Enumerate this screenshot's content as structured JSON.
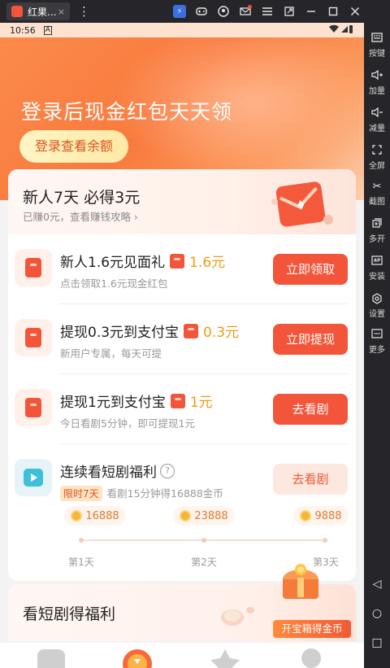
{
  "emulator": {
    "tab_title": "红果...",
    "tab_close": "×",
    "menu_glyph": "⋮",
    "toolbar_icons": [
      "bolt-icon",
      "gamepad-icon",
      "user-circle-icon",
      "mail-icon",
      "menu-icon",
      "external-window-icon",
      "minimize-icon",
      "maximize-icon",
      "close-icon",
      "collapse-icon"
    ],
    "sidebar": [
      {
        "icon": "keyboard-icon",
        "label": "按键"
      },
      {
        "icon": "volume-up-icon",
        "label": "加量"
      },
      {
        "icon": "volume-down-icon",
        "label": "减量"
      },
      {
        "icon": "fullscreen-icon",
        "label": "全屏"
      },
      {
        "icon": "scissors-icon",
        "label": "截图"
      },
      {
        "icon": "multi-instance-icon",
        "label": "多开"
      },
      {
        "icon": "apk-icon",
        "label": "安装"
      },
      {
        "icon": "settings-icon",
        "label": "设置"
      },
      {
        "icon": "more-icon",
        "label": "更多"
      }
    ],
    "nav": {
      "back": "◁",
      "home": "○",
      "recents": "□"
    }
  },
  "status_bar": {
    "time": "10:56",
    "notif": "A"
  },
  "hero": {
    "title": "登录后现金红包天天领",
    "login_button": "登录查看余额"
  },
  "newbie": {
    "title": "新人7天 必得3元",
    "subtitle": "已赚0元，查看赚钱攻略 ›"
  },
  "tasks": [
    {
      "title": "新人1.6元见面礼",
      "reward": "1.6元",
      "subtitle": "点击领取1.6元现金红包",
      "button": "立即领取",
      "style": "primary"
    },
    {
      "title": "提现0.3元到支付宝",
      "reward": "0.3元",
      "subtitle": "新用户专属，每天可提",
      "button": "立即提现",
      "style": "primary"
    },
    {
      "title": "提现1元到支付宝",
      "reward": "1元",
      "subtitle": "今日看剧5分钟，即可提现1元",
      "button": "去看剧",
      "style": "primary"
    }
  ],
  "streak": {
    "title": "连续看短剧福利",
    "help": "?",
    "badge": "限时7天",
    "subtitle": "看剧15分钟得16888金币",
    "button": "去看剧",
    "days": [
      {
        "coins": "16888",
        "label": "第1天"
      },
      {
        "coins": "23888",
        "label": "第2天"
      },
      {
        "coins": "9888",
        "label": "第3天"
      }
    ]
  },
  "drama": {
    "title": "看短剧得福利",
    "chest_banner": "开宝箱得金币"
  },
  "colors": {
    "accent": "#f2553a",
    "reward": "#f19b14",
    "hero_start": "#fb8a4a"
  }
}
